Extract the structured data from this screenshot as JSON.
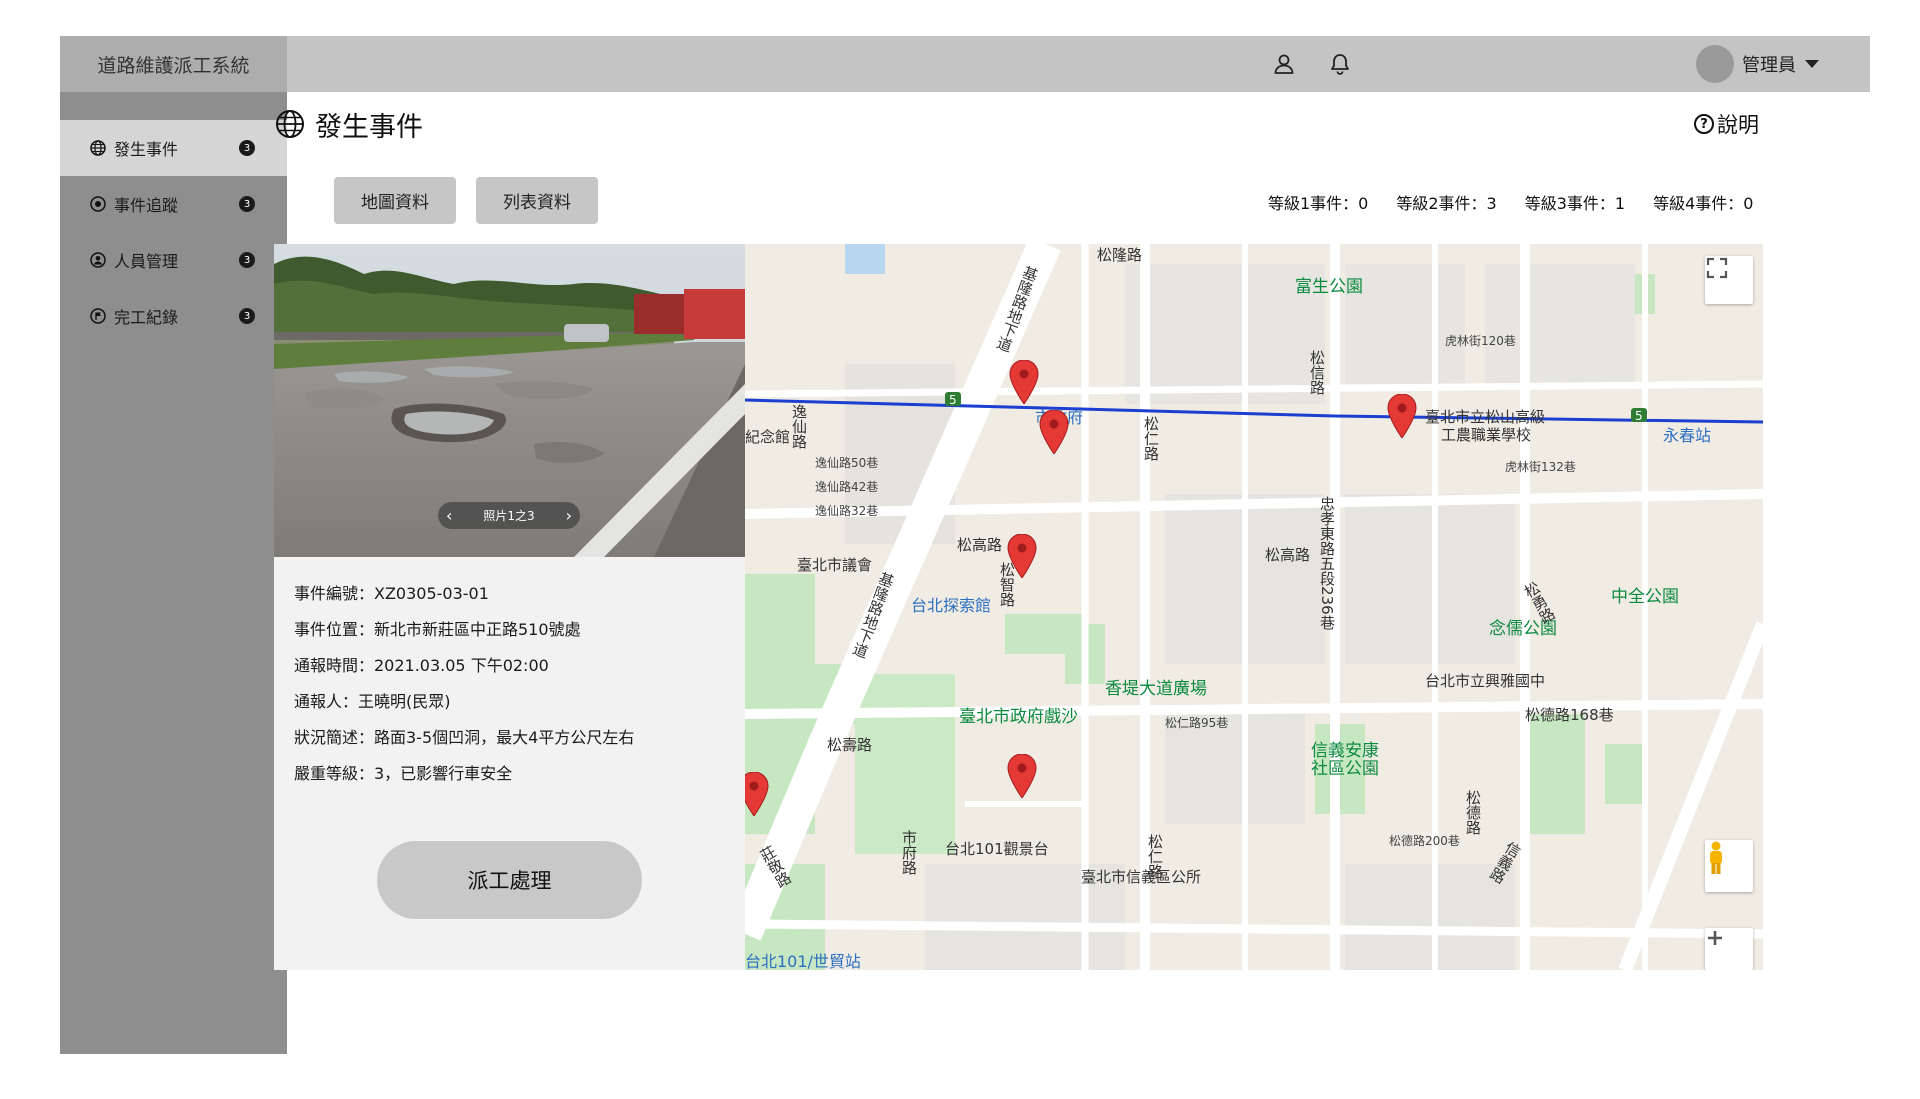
{
  "app": {
    "title": "道路維護派工系統",
    "user_name": "管理員"
  },
  "header_icons": [
    "user-icon",
    "bell-icon"
  ],
  "sidebar": {
    "items": [
      {
        "label": "發生事件",
        "badge": "3",
        "icon": "globe-icon",
        "active": true
      },
      {
        "label": "事件追蹤",
        "badge": "3",
        "icon": "eye-icon",
        "active": false
      },
      {
        "label": "人員管理",
        "badge": "3",
        "icon": "person-circle-icon",
        "active": false
      },
      {
        "label": "完工紀錄",
        "badge": "3",
        "icon": "flag-circle-icon",
        "active": false
      }
    ]
  },
  "page": {
    "title": "發生事件",
    "help_label": "說明"
  },
  "tabs": {
    "map_label": "地圖資料",
    "list_label": "列表資料"
  },
  "levels": [
    "等級1事件：0",
    "等級2事件：3",
    "等級3事件：1",
    "等級4事件：0"
  ],
  "photo": {
    "counter": "照片1之3"
  },
  "event": {
    "id": "事件編號：XZ0305-03-01",
    "location": "事件位置：新北市新莊區中正路510號處",
    "time": "通報時間：2021.03.05 下午02:00",
    "reporter": "通報人：王曉明(民眾)",
    "summary": "狀況簡述：路面3-5個凹洞，最大4平方公尺左右",
    "severity": "嚴重等級：3，已影響行車安全"
  },
  "dispatch_label": "派工處理",
  "map": {
    "labels": {
      "songlong": "松隆路",
      "fusheng_park": "富生公園",
      "city_hall": "市政府",
      "songshan_school_1": "臺北市立松山高級",
      "songshan_school_2": "工農職業學校",
      "yongchun": "永春站",
      "memorial": "紀念館",
      "songgao_1": "松高路",
      "songgao_2": "松高路",
      "council": "臺北市議會",
      "discovery": "台北探索館",
      "xiangti": "香堤大道廣場",
      "theater": "臺北市政府戲沙",
      "zhongquan_park": "中全公園",
      "nianru_park": "念儒公園",
      "xingya": "台北市立興雅國中",
      "songde168": "松德路168巷",
      "xinyi_park_1": "信義安康",
      "xinyi_park_2": "社區公園",
      "songshou": "松壽路",
      "taipei101_view": "台北101觀景台",
      "xinyi_office": "臺北市信義區公所",
      "taipei101_station": "台北101/世貿站",
      "keelung_1": "基隆路地下道",
      "keelung_2": "基隆路地下道",
      "yixian": "逸仙路",
      "songren_1": "松仁路",
      "songren_2": "松仁路",
      "zhongxiao_236": "忠孝東路五段236巷",
      "huaixin": "松信路",
      "zhuangjing": "莊敬路",
      "shifu": "市府路",
      "songzhi": "松智路",
      "hulin120": "虎林街120巷",
      "hulin132": "虎林街132巷",
      "yixian50": "逸仙路50巷",
      "yixian42": "逸仙路42巷",
      "yixian32": "逸仙路32巷",
      "songren95": "松仁路95巷",
      "songde200": "松德路200巷",
      "songde_road": "松德路",
      "xinyi_road": "信義路",
      "songjiang": "松勇路",
      "metro_5a": "5",
      "metro_5b": "5"
    },
    "pins": 6,
    "controls": [
      "fullscreen-icon",
      "pegman-icon",
      "zoom-in-icon"
    ]
  },
  "colors": {
    "topbar": "#c4c4c4",
    "brand_bg": "#adadad",
    "sidebar": "#8e8e8e",
    "sidebar_active": "#d5d5d5",
    "pin": "#e53935",
    "metro_line": "#1a3fd1",
    "park": "#c7e7c2"
  }
}
